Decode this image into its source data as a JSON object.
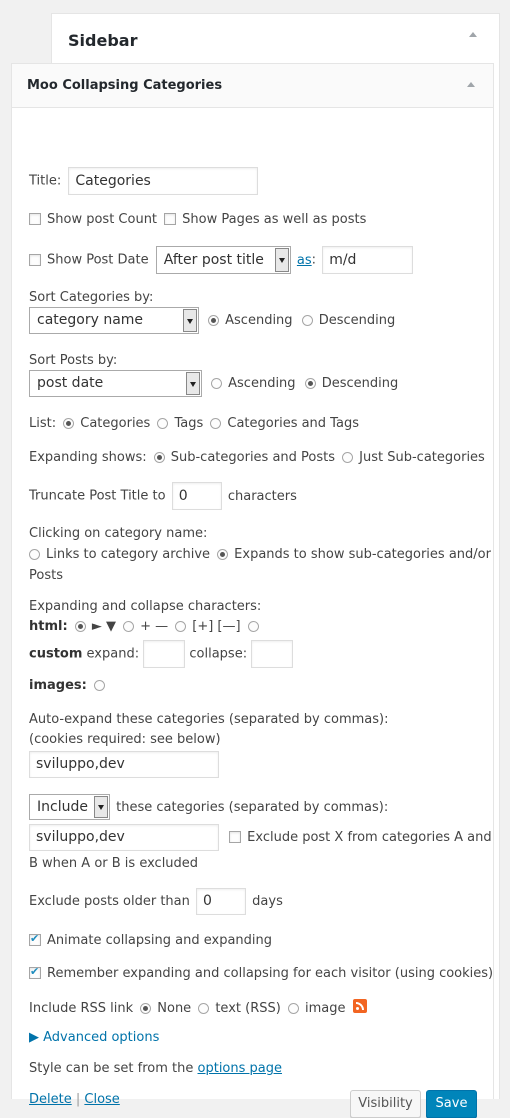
{
  "sidebar": {
    "title": "Sidebar"
  },
  "widget": {
    "title": "Moo Collapsing Categories",
    "title_label": "Title:",
    "title_value": "Categories",
    "show_post_count": "Show post Count",
    "show_pages": "Show Pages as well as posts",
    "show_post_date": "Show Post Date",
    "post_date_position": "After post title",
    "as_link": "as",
    "colon": ":",
    "date_format": "m/d",
    "sort_categories_label": "Sort Categories by:",
    "sort_categories_value": "category name",
    "ascending": "Ascending",
    "descending": "Descending",
    "sort_posts_label": "Sort Posts by:",
    "sort_posts_value": "post date",
    "list_label": "List:",
    "list_categories": "Categories",
    "list_tags": "Tags",
    "list_both": "Categories and Tags",
    "expanding_shows_label": "Expanding shows:",
    "expanding_sub_and_posts": "Sub-categories and Posts",
    "expanding_just_sub": "Just Sub-categories",
    "truncate_label": "Truncate Post Title to",
    "truncate_value": "0",
    "characters": "characters",
    "clicking_label": "Clicking on category name:",
    "clicking_links": "Links to category archive",
    "clicking_expands": "Expands to show sub-categories and/or",
    "clicking_expands_2": "Posts",
    "expand_chars_label": "Expanding and collapse characters:",
    "html_label": "html:",
    "chars_triangles": "► ▼",
    "chars_plusminus": "+ —",
    "chars_brackets": "[+] [—]",
    "custom_label": "custom",
    "expand_label": "expand:",
    "collapse_label": "collapse:",
    "images_label": "images:",
    "autoexpand_label": "Auto-expand these categories (separated by commas):",
    "autoexpand_note": "(cookies required: see below)",
    "autoexpand_value": "sviluppo,dev",
    "include_value": "Include",
    "include_label": "these categories (separated by commas):",
    "include_categories_value": "sviluppo,dev",
    "exclude_post_label": "Exclude post X from categories A and",
    "exclude_post_label_2": "B when A or B is excluded",
    "exclude_older_label": "Exclude posts older than",
    "exclude_older_value": "0",
    "days": "days",
    "animate_label": "Animate collapsing and expanding",
    "remember_label": "Remember expanding and collapsing for each visitor (using cookies)",
    "rss_label": "Include RSS link",
    "rss_none": "None",
    "rss_text": "text (RSS)",
    "rss_image": "image",
    "advanced_options": "▶ Advanced options",
    "style_note": "Style can be set from the",
    "options_page_link": "options page",
    "delete_link": "Delete",
    "separator": "|",
    "close_link": "Close",
    "visibility_button": "Visibility",
    "save_button": "Save"
  },
  "colors": {
    "accent": "#0085ba",
    "link": "#0073aa"
  }
}
